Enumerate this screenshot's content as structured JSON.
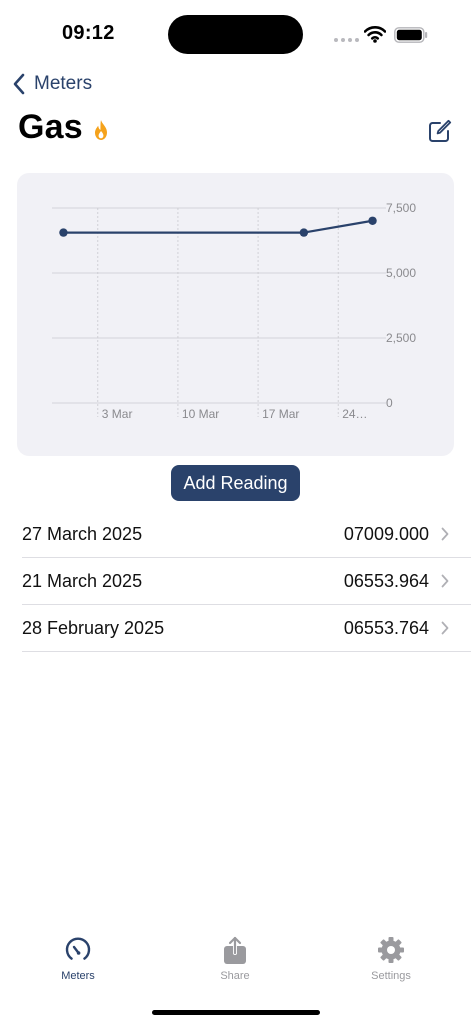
{
  "status_bar": {
    "time": "09:12"
  },
  "nav": {
    "back_label": "Meters",
    "title": "Gas",
    "title_icon": "flame-icon",
    "edit_icon": "edit-icon"
  },
  "colors": {
    "accent": "#2a426b",
    "flame": "#f5a21b",
    "chart_background": "#f1f1f6",
    "tab_inactive": "#9a9a9e"
  },
  "chart_data": {
    "type": "line",
    "x": [
      "2025-02-28",
      "2025-03-21",
      "2025-03-27"
    ],
    "series": [
      {
        "values": [
          6553.764,
          6553.964,
          7009.0
        ]
      }
    ],
    "x_ticks": [
      "3 Mar",
      "10 Mar",
      "17 Mar",
      "24…"
    ],
    "y_ticks": [
      "0",
      "2,500",
      "5,000",
      "7,500"
    ],
    "y_tick_values": [
      0,
      2500,
      5000,
      7500
    ],
    "ylim": [
      0,
      7500
    ],
    "y_axis_position": "right",
    "grid": true,
    "markers": true
  },
  "add_reading_label": "Add Reading",
  "readings": [
    {
      "date": "27 March 2025",
      "value": "07009.000"
    },
    {
      "date": "21 March 2025",
      "value": "06553.964"
    },
    {
      "date": "28 February 2025",
      "value": "06553.764"
    }
  ],
  "tabs": [
    {
      "label": "Meters",
      "icon": "gauge-icon",
      "selected": true
    },
    {
      "label": "Share",
      "icon": "share-icon",
      "selected": false
    },
    {
      "label": "Settings",
      "icon": "gear-icon",
      "selected": false
    }
  ]
}
